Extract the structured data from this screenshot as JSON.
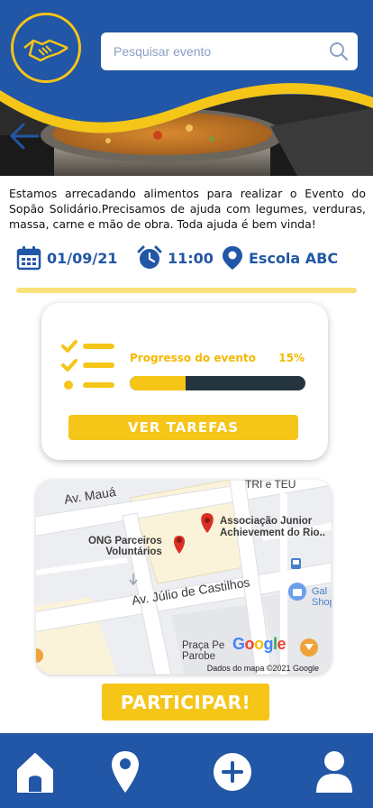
{
  "search": {
    "placeholder": "Pesquisar evento",
    "value": ""
  },
  "event": {
    "description": "Estamos arrecadando alimentos para realizar o Evento do Sopão Solidário.Precisamos de ajuda com legumes, verduras, massa, carne e mão de obra. Toda ajuda é bem vinda!",
    "date": "01/09/21",
    "time": "11:00",
    "location": "Escola ABC"
  },
  "progress": {
    "label": "Progresso do evento",
    "percent_text": "15%",
    "fraction": 0.32,
    "tasks_button": "VER TAREFAS"
  },
  "map": {
    "streets": {
      "maua": "Av. Mauá",
      "castilhos": "Av. Júlio de Castilhos",
      "tri": "TRI e TEU"
    },
    "places": {
      "ong": "ONG Parceiros Voluntários",
      "junior": "Associação Junior Achievement do Rio..",
      "praca": "Praça Pereira Parobe",
      "gal": "Gal Shop"
    },
    "ong_line1": "ONG Parceiros",
    "ong_line2": "Voluntários",
    "junior_line1": "Associação Junior",
    "junior_line2": "Achievement do Rio..",
    "praca_line1": "Praça Pe",
    "praca_line2": "Parobe",
    "gal_line1": "Gal",
    "gal_line2": "Shop",
    "credit": "Dados do mapa ©2021 Google",
    "google": "Google"
  },
  "actions": {
    "join": "PARTICIPAR!"
  },
  "colors": {
    "primary": "#2256a6",
    "accent": "#f5c518",
    "pin": "#d93025"
  },
  "nav": [
    "home-icon",
    "location-icon",
    "add-icon",
    "profile-icon"
  ]
}
